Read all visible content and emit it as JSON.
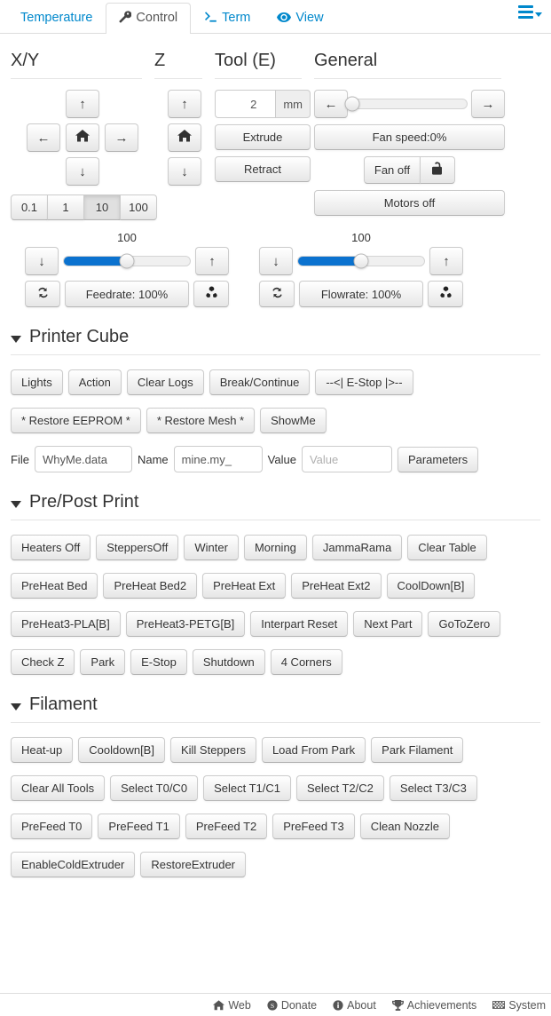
{
  "tabs": [
    {
      "label": "Temperature",
      "icon": "",
      "active": false
    },
    {
      "label": "Control",
      "icon": "wrench-icon",
      "active": true
    },
    {
      "label": "Term",
      "icon": "terminal-icon",
      "active": false
    },
    {
      "label": "View",
      "icon": "eye-icon",
      "active": false
    }
  ],
  "menu_button": {
    "name": "hamburger-menu"
  },
  "controls": {
    "xy": {
      "title": "X/Y",
      "up": "↑",
      "down": "↓",
      "left": "←",
      "right": "→",
      "home": "home-icon",
      "steps": [
        "0.1",
        "1",
        "10",
        "100"
      ],
      "active_step": "10"
    },
    "z": {
      "title": "Z",
      "up": "↑",
      "down": "↓",
      "home": "home-icon"
    },
    "tool": {
      "title": "Tool (E)",
      "amount": "2",
      "unit": "mm",
      "extrude": "Extrude",
      "retract": "Retract"
    },
    "general": {
      "title": "General",
      "left_arrow": "←",
      "right_arrow": "→",
      "fan_slider_percent": 0,
      "fan_speed": "Fan speed:0%",
      "fan_off": "Fan off",
      "lock": "lock-icon",
      "motors_off": "Motors off"
    },
    "feedrate": {
      "value": "100",
      "slider_percent": 50,
      "down": "↓",
      "up": "↑",
      "refresh": "refresh-icon",
      "label": "Feedrate: 100%",
      "extra": "radioactive-icon"
    },
    "flowrate": {
      "value": "100",
      "slider_percent": 50,
      "down": "↓",
      "up": "↑",
      "refresh": "refresh-icon",
      "label": "Flowrate: 100%",
      "extra": "radioactive-icon"
    }
  },
  "sections": [
    {
      "title": "Printer Cube",
      "rows": [
        [
          "Lights",
          "Action",
          "Clear Logs",
          "Break/Continue",
          "--<| E-Stop |>--"
        ],
        [
          "* Restore EEPROM *",
          "* Restore Mesh *",
          "ShowMe"
        ]
      ],
      "form": {
        "file_label": "File",
        "file_value": "WhyMe.data",
        "name_label": "Name",
        "name_value": "mine.my_",
        "value_label": "Value",
        "value_value": "",
        "value_placeholder": "Value",
        "parameters_button": "Parameters"
      }
    },
    {
      "title": "Pre/Post Print",
      "rows": [
        [
          "Heaters Off",
          "SteppersOff",
          "Winter",
          "Morning",
          "JammaRama",
          "Clear Table"
        ],
        [
          "PreHeat Bed",
          "PreHeat Bed2",
          "PreHeat Ext",
          "PreHeat Ext2",
          "CoolDown[B]"
        ],
        [
          "PreHeat3-PLA[B]",
          "PreHeat3-PETG[B]",
          "Interpart Reset",
          "Next Part",
          "GoToZero"
        ],
        [
          "Check Z",
          "Park",
          "E-Stop",
          "Shutdown",
          "4 Corners"
        ]
      ]
    },
    {
      "title": "Filament",
      "rows": [
        [
          "Heat-up",
          "Cooldown[B]",
          "Kill Steppers",
          "Load From Park",
          "Park Filament"
        ],
        [
          "Clear All Tools",
          "Select T0/C0",
          "Select T1/C1",
          "Select T2/C2",
          "Select T3/C3"
        ],
        [
          "PreFeed T0",
          "PreFeed T1",
          "PreFeed T2",
          "PreFeed T3",
          "Clean Nozzle"
        ],
        [
          "EnableColdExtruder",
          "RestoreExtruder"
        ]
      ]
    }
  ],
  "footer": [
    {
      "label": "Web",
      "icon": "home-icon"
    },
    {
      "label": "Donate",
      "icon": "money-icon"
    },
    {
      "label": "About",
      "icon": "info-icon"
    },
    {
      "label": "Achievements",
      "icon": "trophy-icon"
    },
    {
      "label": "System",
      "icon": "flag-icon"
    }
  ],
  "colors": {
    "link_blue": "#0088cc",
    "slider_blue": "#0b72cf",
    "text": "#333333",
    "border": "#dddddd"
  }
}
